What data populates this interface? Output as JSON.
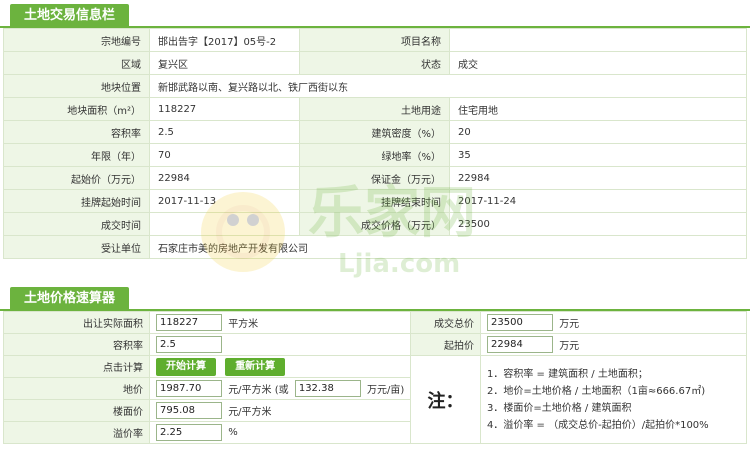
{
  "land_info": {
    "title": "土地交易信息栏",
    "rows": [
      {
        "l1": "宗地编号",
        "v1": "邯出告字【2017】05号-2",
        "l2": "项目名称",
        "v2": ""
      },
      {
        "l1": "区域",
        "v1": "复兴区",
        "l2": "状态",
        "v2": "成交"
      },
      {
        "l1": "地块位置",
        "v1": "新邯武路以南、复兴路以北、铁厂西街以东",
        "wide": true
      },
      {
        "l1": "地块面积（m²）",
        "v1": "118227",
        "l2": "土地用途",
        "v2": "住宅用地"
      },
      {
        "l1": "容积率",
        "v1": "2.5",
        "l2": "建筑密度（%）",
        "v2": "20"
      },
      {
        "l1": "年限（年）",
        "v1": "70",
        "l2": "绿地率（%）",
        "v2": "35"
      },
      {
        "l1": "起始价（万元）",
        "v1": "22984",
        "l2": "保证金（万元）",
        "v2": "22984"
      },
      {
        "l1": "挂牌起始时间",
        "v1": "2017-11-13",
        "l2": "挂牌结束时间",
        "v2": "2017-11-24"
      },
      {
        "l1": "成交时间",
        "v1": "",
        "l2": "成交价格（万元）",
        "v2": "23500"
      },
      {
        "l1": "受让单位",
        "v1": "石家庄市美的房地产开发有限公司",
        "wide": true
      }
    ]
  },
  "calculator": {
    "title": "土地价格速算器",
    "area_label": "出让实际面积",
    "area_value": "118227",
    "area_unit": "平方米",
    "total_label": "成交总价",
    "total_value": "23500",
    "total_unit": "万元",
    "far_label": "容积率",
    "far_value": "2.5",
    "start_label": "起拍价",
    "start_value": "22984",
    "start_unit": "万元",
    "click_label": "点击计算",
    "btn_start": "开始计算",
    "btn_reset": "重新计算",
    "land_price_label": "地价",
    "land_price_value": "1987.70",
    "land_price_unit_a": "元/平方米 (或",
    "land_price_mu_value": "132.38",
    "land_price_unit_b": "万元/亩)",
    "floor_price_label": "楼面价",
    "floor_price_value": "795.08",
    "floor_price_unit": "元/平方米",
    "premium_label": "溢价率",
    "premium_value": "2.25",
    "premium_unit": "%",
    "note_title": "注：",
    "notes": [
      "1．容积率 = 建筑面积 / 土地面积；",
      "2．地价=土地价格 / 土地面积（1亩≈666.67㎡)",
      "3．楼面价=土地价格 / 建筑面积",
      "4．溢价率 = （成交总价-起拍价）/起拍价*100%"
    ]
  },
  "watermark": {
    "text": "Ljia.com",
    "brand": "乐家网"
  },
  "colors": {
    "accent": "#6cb33e",
    "label_bg": "#eef6e6",
    "border": "#d9e6cc"
  }
}
